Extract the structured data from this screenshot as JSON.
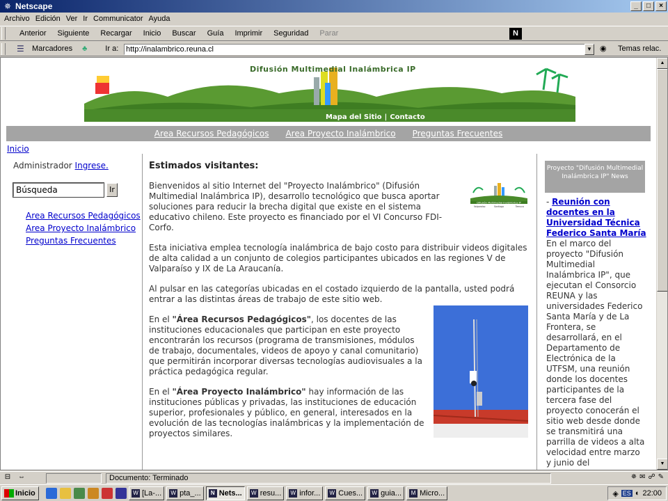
{
  "window": {
    "title": "Netscape"
  },
  "menu": [
    "Archivo",
    "Edición",
    "Ver",
    "Ir",
    "Communicator",
    "Ayuda"
  ],
  "nav_buttons": [
    {
      "label": "Anterior",
      "enabled": true
    },
    {
      "label": "Siguiente",
      "enabled": true
    },
    {
      "label": "Recargar",
      "enabled": true
    },
    {
      "label": "Inicio",
      "enabled": true
    },
    {
      "label": "Buscar",
      "enabled": true
    },
    {
      "label": "Guía",
      "enabled": true
    },
    {
      "label": "Imprimir",
      "enabled": true
    },
    {
      "label": "Seguridad",
      "enabled": true
    },
    {
      "label": "Parar",
      "enabled": false
    }
  ],
  "netscape_logo": "N",
  "location": {
    "bookmarks_label": "Marcadores",
    "goto_label": "Ir a:",
    "url": "http://inalambrico.reuna.cl",
    "related_label": "Temas relac."
  },
  "banner": {
    "title": "Difusión Multimedial Inalámbrica IP",
    "sitemap": "Mapa del Sitio",
    "separator": "|",
    "contact": "Contacto"
  },
  "topnav": [
    "Area Recursos Pedagógicos",
    "Area Proyecto Inalámbrico",
    "Preguntas Frecuentes"
  ],
  "breadcrumb": "Inicio",
  "left": {
    "admin_label": "Administrador",
    "admin_link": "Ingrese.",
    "search_value": "Búsqueda",
    "search_button": "Ir",
    "links": [
      "Area Recursos Pedagógicos",
      "Area Proyecto Inalámbrico",
      "Preguntas Frecuentes"
    ]
  },
  "main": {
    "heading": "Estimados visitantes:",
    "p1": "Bienvenidos al sitio Internet del \"Proyecto Inalámbrico\" (Difusión Multimedial Inalámbrica IP), desarrollo tecnológico que busca aportar soluciones para reducir la brecha digital que existe en el sistema educativo chileno. Este proyecto es financiado por el VI Concurso FDI-Corfo.",
    "p2": "Esta iniciativa emplea tecnología inalámbrica de bajo costo para distribuir videos digitales de alta calidad a un conjunto de colegios participantes ubicados en las regiones V de Valparaíso y IX de La Araucanía.",
    "p3": "Al pulsar en las categorías ubicadas en el costado izquierdo de la pantalla, usted podrá entrar a las distintas áreas de trabajo de este sitio web.",
    "p4_prefix": "En el ",
    "p4_bold": "\"Área Recursos Pedagógicos\"",
    "p4_rest": ", los docentes de las instituciones educacionales que participan en este proyecto encontrarán los recursos (programa de transmisiones, módulos de trabajo, documentales, videos de apoyo y canal comunitario) que permitirán incorporar diversas tecnologías audiovisuales a la práctica pedagógica regular.",
    "p5_prefix": "En el ",
    "p5_bold": "\"Área Proyecto Inalámbrico\"",
    "p5_rest": " hay información de las instituciones públicas y privadas, las instituciones de educación superior, profesionales y público, en general, interesados en la evolución de las tecnologías inalámbricas y la implementación de proyectos similares.",
    "logo_small_caption": "Difusión Multimedial Inalámbrica IP",
    "logo_small_places": [
      "Valparaíso",
      "Santiago",
      "Temuco"
    ]
  },
  "news": {
    "header": "Proyecto \"Difusión Multimedial Inalámbrica IP\" News",
    "bullet": "-",
    "title": "Reunión con docentes en la Universidad Técnica Federico Santa María",
    "body": "En el marco del proyecto \"Difusión Multimedial Inalámbrica IP\", que ejecutan el Consorcio REUNA y las universidades Federico Santa María y de La Frontera, se desarrollará, en el Departamento de Electrónica de la UTFSM, una reunión donde los docentes participantes de la tercera fase del proyecto conocerán el sitio web desde donde se transmitirá una parrilla de videos a alta velocidad entre marzo y junio del"
  },
  "status": {
    "text": "Documento: Terminado"
  },
  "taskbar": {
    "start": "Inicio",
    "tasks": [
      {
        "label": "[La-...",
        "active": false
      },
      {
        "label": "pta_...",
        "active": false
      },
      {
        "label": "Nets...",
        "active": true
      },
      {
        "label": "resu...",
        "active": false
      },
      {
        "label": "infor...",
        "active": false
      },
      {
        "label": "Cues...",
        "active": false
      },
      {
        "label": "guia...",
        "active": false
      },
      {
        "label": "Micro...",
        "active": false
      }
    ],
    "lang": "ES",
    "clock": "22:00"
  }
}
